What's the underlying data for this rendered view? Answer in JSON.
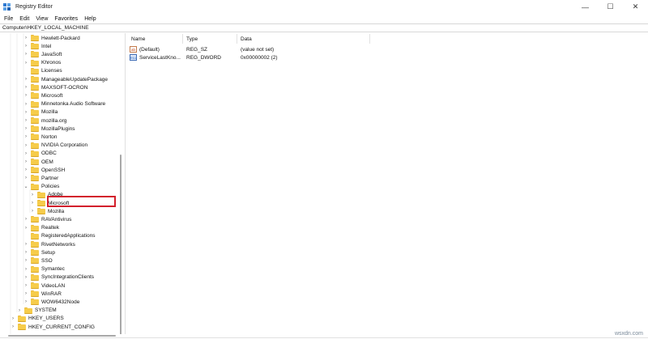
{
  "window": {
    "title": "Registry Editor",
    "controls": {
      "minimize": "—",
      "maximize": "☐",
      "close": "✕"
    }
  },
  "menu": [
    "File",
    "Edit",
    "View",
    "Favorites",
    "Help"
  ],
  "address": "Computer\\HKEY_LOCAL_MACHINE",
  "tree": [
    {
      "label": "Hewlett-Packard",
      "level": 3,
      "expander": "closed"
    },
    {
      "label": "Intel",
      "level": 3,
      "expander": "closed"
    },
    {
      "label": "JavaSoft",
      "level": 3,
      "expander": "closed"
    },
    {
      "label": "Khronos",
      "level": 3,
      "expander": "closed"
    },
    {
      "label": "Licenses",
      "level": 3,
      "expander": "none"
    },
    {
      "label": "ManageableUpdatePackage",
      "level": 3,
      "expander": "closed"
    },
    {
      "label": "MAXSOFT-OCRON",
      "level": 3,
      "expander": "closed"
    },
    {
      "label": "Microsoft",
      "level": 3,
      "expander": "closed"
    },
    {
      "label": "Minnetonka Audio Software",
      "level": 3,
      "expander": "closed"
    },
    {
      "label": "Mozilla",
      "level": 3,
      "expander": "closed"
    },
    {
      "label": "mozilla.org",
      "level": 3,
      "expander": "closed"
    },
    {
      "label": "MozillaPlugins",
      "level": 3,
      "expander": "closed"
    },
    {
      "label": "Norton",
      "level": 3,
      "expander": "closed"
    },
    {
      "label": "NVIDIA Corporation",
      "level": 3,
      "expander": "closed"
    },
    {
      "label": "ODBC",
      "level": 3,
      "expander": "closed"
    },
    {
      "label": "OEM",
      "level": 3,
      "expander": "closed"
    },
    {
      "label": "OpenSSH",
      "level": 3,
      "expander": "closed"
    },
    {
      "label": "Partner",
      "level": 3,
      "expander": "closed"
    },
    {
      "label": "Policies",
      "level": 3,
      "expander": "open"
    },
    {
      "label": "Adobe",
      "level": 4,
      "expander": "closed"
    },
    {
      "label": "Microsoft",
      "level": 4,
      "expander": "closed",
      "selected": true
    },
    {
      "label": "Mozilla",
      "level": 4,
      "expander": "closed"
    },
    {
      "label": "RAVAntivirus",
      "level": 3,
      "expander": "closed"
    },
    {
      "label": "Realtek",
      "level": 3,
      "expander": "closed"
    },
    {
      "label": "RegisteredApplications",
      "level": 3,
      "expander": "none"
    },
    {
      "label": "RivetNetworks",
      "level": 3,
      "expander": "closed"
    },
    {
      "label": "Setup",
      "level": 3,
      "expander": "closed"
    },
    {
      "label": "SSO",
      "level": 3,
      "expander": "closed"
    },
    {
      "label": "Symantec",
      "level": 3,
      "expander": "closed"
    },
    {
      "label": "SyncIntegrationClients",
      "level": 3,
      "expander": "closed"
    },
    {
      "label": "VideoLAN",
      "level": 3,
      "expander": "closed"
    },
    {
      "label": "WinRAR",
      "level": 3,
      "expander": "closed"
    },
    {
      "label": "WOW6432Node",
      "level": 3,
      "expander": "closed"
    },
    {
      "label": "SYSTEM",
      "level": 2,
      "expander": "closed"
    },
    {
      "label": "HKEY_USERS",
      "level": 1,
      "expander": "closed"
    },
    {
      "label": "HKEY_CURRENT_CONFIG",
      "level": 1,
      "expander": "closed"
    }
  ],
  "columns": {
    "name": "Name",
    "type": "Type",
    "data": "Data"
  },
  "values": [
    {
      "name": "(Default)",
      "type": "REG_SZ",
      "data": "(value not set)",
      "icon": "string-value-icon",
      "icon_text": "ab"
    },
    {
      "name": "ServiceLastKno...",
      "type": "REG_DWORD",
      "data": "0x00000002 (2)",
      "icon": "dword-value-icon",
      "icon_text": "011"
    }
  ],
  "watermark": "wsxdn.com",
  "colors": {
    "highlight": "#d3202c",
    "folder": "#f6cc4b"
  }
}
